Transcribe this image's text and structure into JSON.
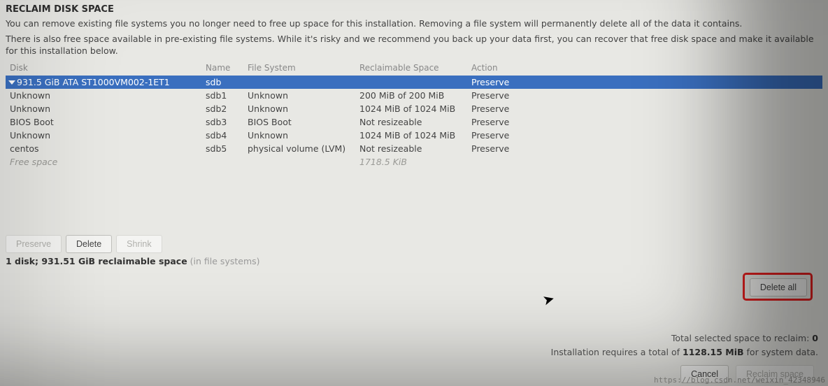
{
  "title": "RECLAIM DISK SPACE",
  "desc1": "You can remove existing file systems you no longer need to free up space for this installation.  Removing a file system will permanently delete all of the data it contains.",
  "desc2": "There is also free space available in pre-existing file systems.  While it's risky and we recommend you back up your data first, you can recover that free disk space and make it available for this installation below.",
  "columns": {
    "disk": "Disk",
    "name": "Name",
    "fs": "File System",
    "reclaim": "Reclaimable Space",
    "action": "Action"
  },
  "rows": [
    {
      "disk": "931.5 GiB ATA ST1000VM002-1ET1",
      "name": "sdb",
      "fs": "",
      "reclaim": "",
      "action": "Preserve",
      "selected": true,
      "indent": 0
    },
    {
      "disk": "Unknown",
      "name": "sdb1",
      "fs": "Unknown",
      "reclaim": "200 MiB of 200 MiB",
      "action": "Preserve",
      "selected": false,
      "indent": 1
    },
    {
      "disk": "Unknown",
      "name": "sdb2",
      "fs": "Unknown",
      "reclaim": "1024 MiB of 1024 MiB",
      "action": "Preserve",
      "selected": false,
      "indent": 1
    },
    {
      "disk": "BIOS Boot",
      "name": "sdb3",
      "fs": "BIOS Boot",
      "reclaim": "Not resizeable",
      "action": "Preserve",
      "selected": false,
      "indent": 1,
      "reclaim_muted": true
    },
    {
      "disk": "Unknown",
      "name": "sdb4",
      "fs": "Unknown",
      "reclaim": "1024 MiB of 1024 MiB",
      "action": "Preserve",
      "selected": false,
      "indent": 1
    },
    {
      "disk": "centos",
      "name": "sdb5",
      "fs": "physical volume (LVM)",
      "reclaim": "Not resizeable",
      "action": "Preserve",
      "selected": false,
      "indent": 1,
      "reclaim_muted": true
    },
    {
      "disk": "Free space",
      "name": "",
      "fs": "",
      "reclaim": "1718.5 KiB",
      "action": "",
      "selected": false,
      "indent": 1,
      "free": true,
      "reclaim_muted": true
    }
  ],
  "toolbar": {
    "preserve": "Preserve",
    "delete": "Delete",
    "shrink": "Shrink"
  },
  "summary": {
    "prefix": "1 disk; 931.51 GiB reclaimable space",
    "suffix": "(in file systems)"
  },
  "delete_all": "Delete all",
  "totals": {
    "line1_prefix": "Total selected space to reclaim: ",
    "line1_value": "0",
    "line2_prefix": "Installation requires a total of ",
    "line2_value": "1128.15 MiB",
    "line2_suffix": " for system data."
  },
  "footer": {
    "cancel": "Cancel",
    "reclaim": "Reclaim space"
  },
  "watermark": "https://blog.csdn.net/weixin_42348946"
}
